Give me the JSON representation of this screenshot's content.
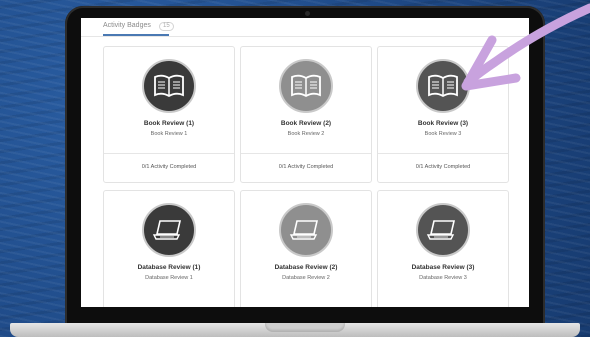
{
  "colors": {
    "background": "#1f4c8c",
    "tab_accent": "#4a79b3",
    "annotation_arrow": "#c8a2de"
  },
  "tabs": {
    "active_label": "Activity Badges",
    "badge_count": "15"
  },
  "cards": [
    {
      "title": "Book Review (1)",
      "subtitle": "Book Review 1",
      "status": "0/1 Activity Completed",
      "icon": "book-icon",
      "tone": "dark"
    },
    {
      "title": "Book Review (2)",
      "subtitle": "Book Review 2",
      "status": "0/1 Activity Completed",
      "icon": "book-icon",
      "tone": "grey"
    },
    {
      "title": "Book Review (3)",
      "subtitle": "Book Review 3",
      "status": "0/1 Activity Completed",
      "icon": "book-icon",
      "tone": "mid"
    },
    {
      "title": "Database Review (1)",
      "subtitle": "Database Review 1",
      "icon": "laptop-icon",
      "tone": "dark"
    },
    {
      "title": "Database Review (2)",
      "subtitle": "Database Review 2",
      "icon": "laptop-icon",
      "tone": "grey"
    },
    {
      "title": "Database Review (3)",
      "subtitle": "Database Review 3",
      "icon": "laptop-icon",
      "tone": "mid"
    }
  ]
}
